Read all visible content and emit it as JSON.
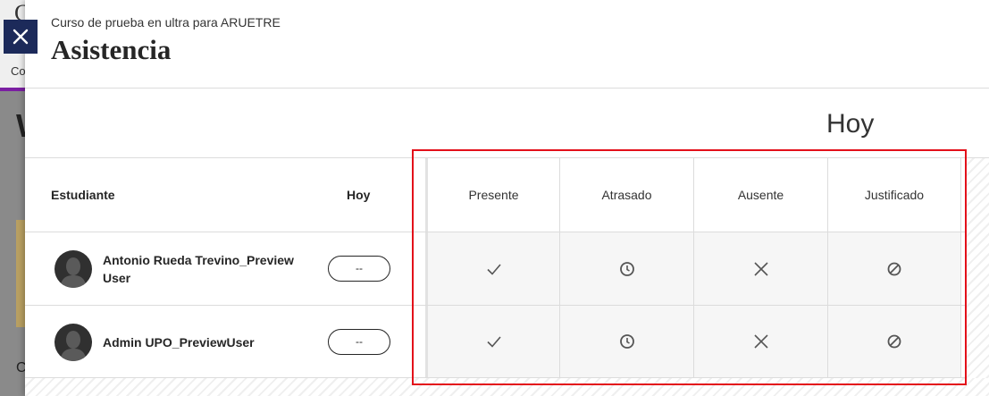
{
  "panel": {
    "course_name": "Curso de prueba en ultra para ARUETRE",
    "title": "Asistencia",
    "close_icon": "close-icon"
  },
  "date_heading": "Hoy",
  "table": {
    "headers": {
      "student": "Estudiante",
      "today": "Hoy",
      "statuses": [
        "Presente",
        "Atrasado",
        "Ausente",
        "Justificado"
      ]
    },
    "status_icons": [
      "checkmark-icon",
      "clock-icon",
      "x-icon",
      "prohibited-icon"
    ],
    "rows": [
      {
        "name": "Antonio Rueda Trevino_PreviewUser",
        "today_value": "--"
      },
      {
        "name": "Admin UPO_PreviewUser",
        "today_value": "--"
      }
    ]
  },
  "colors": {
    "close_button_bg": "#1c2a5a",
    "highlight": "#e3101a",
    "avatar_bg": "#303030"
  }
}
